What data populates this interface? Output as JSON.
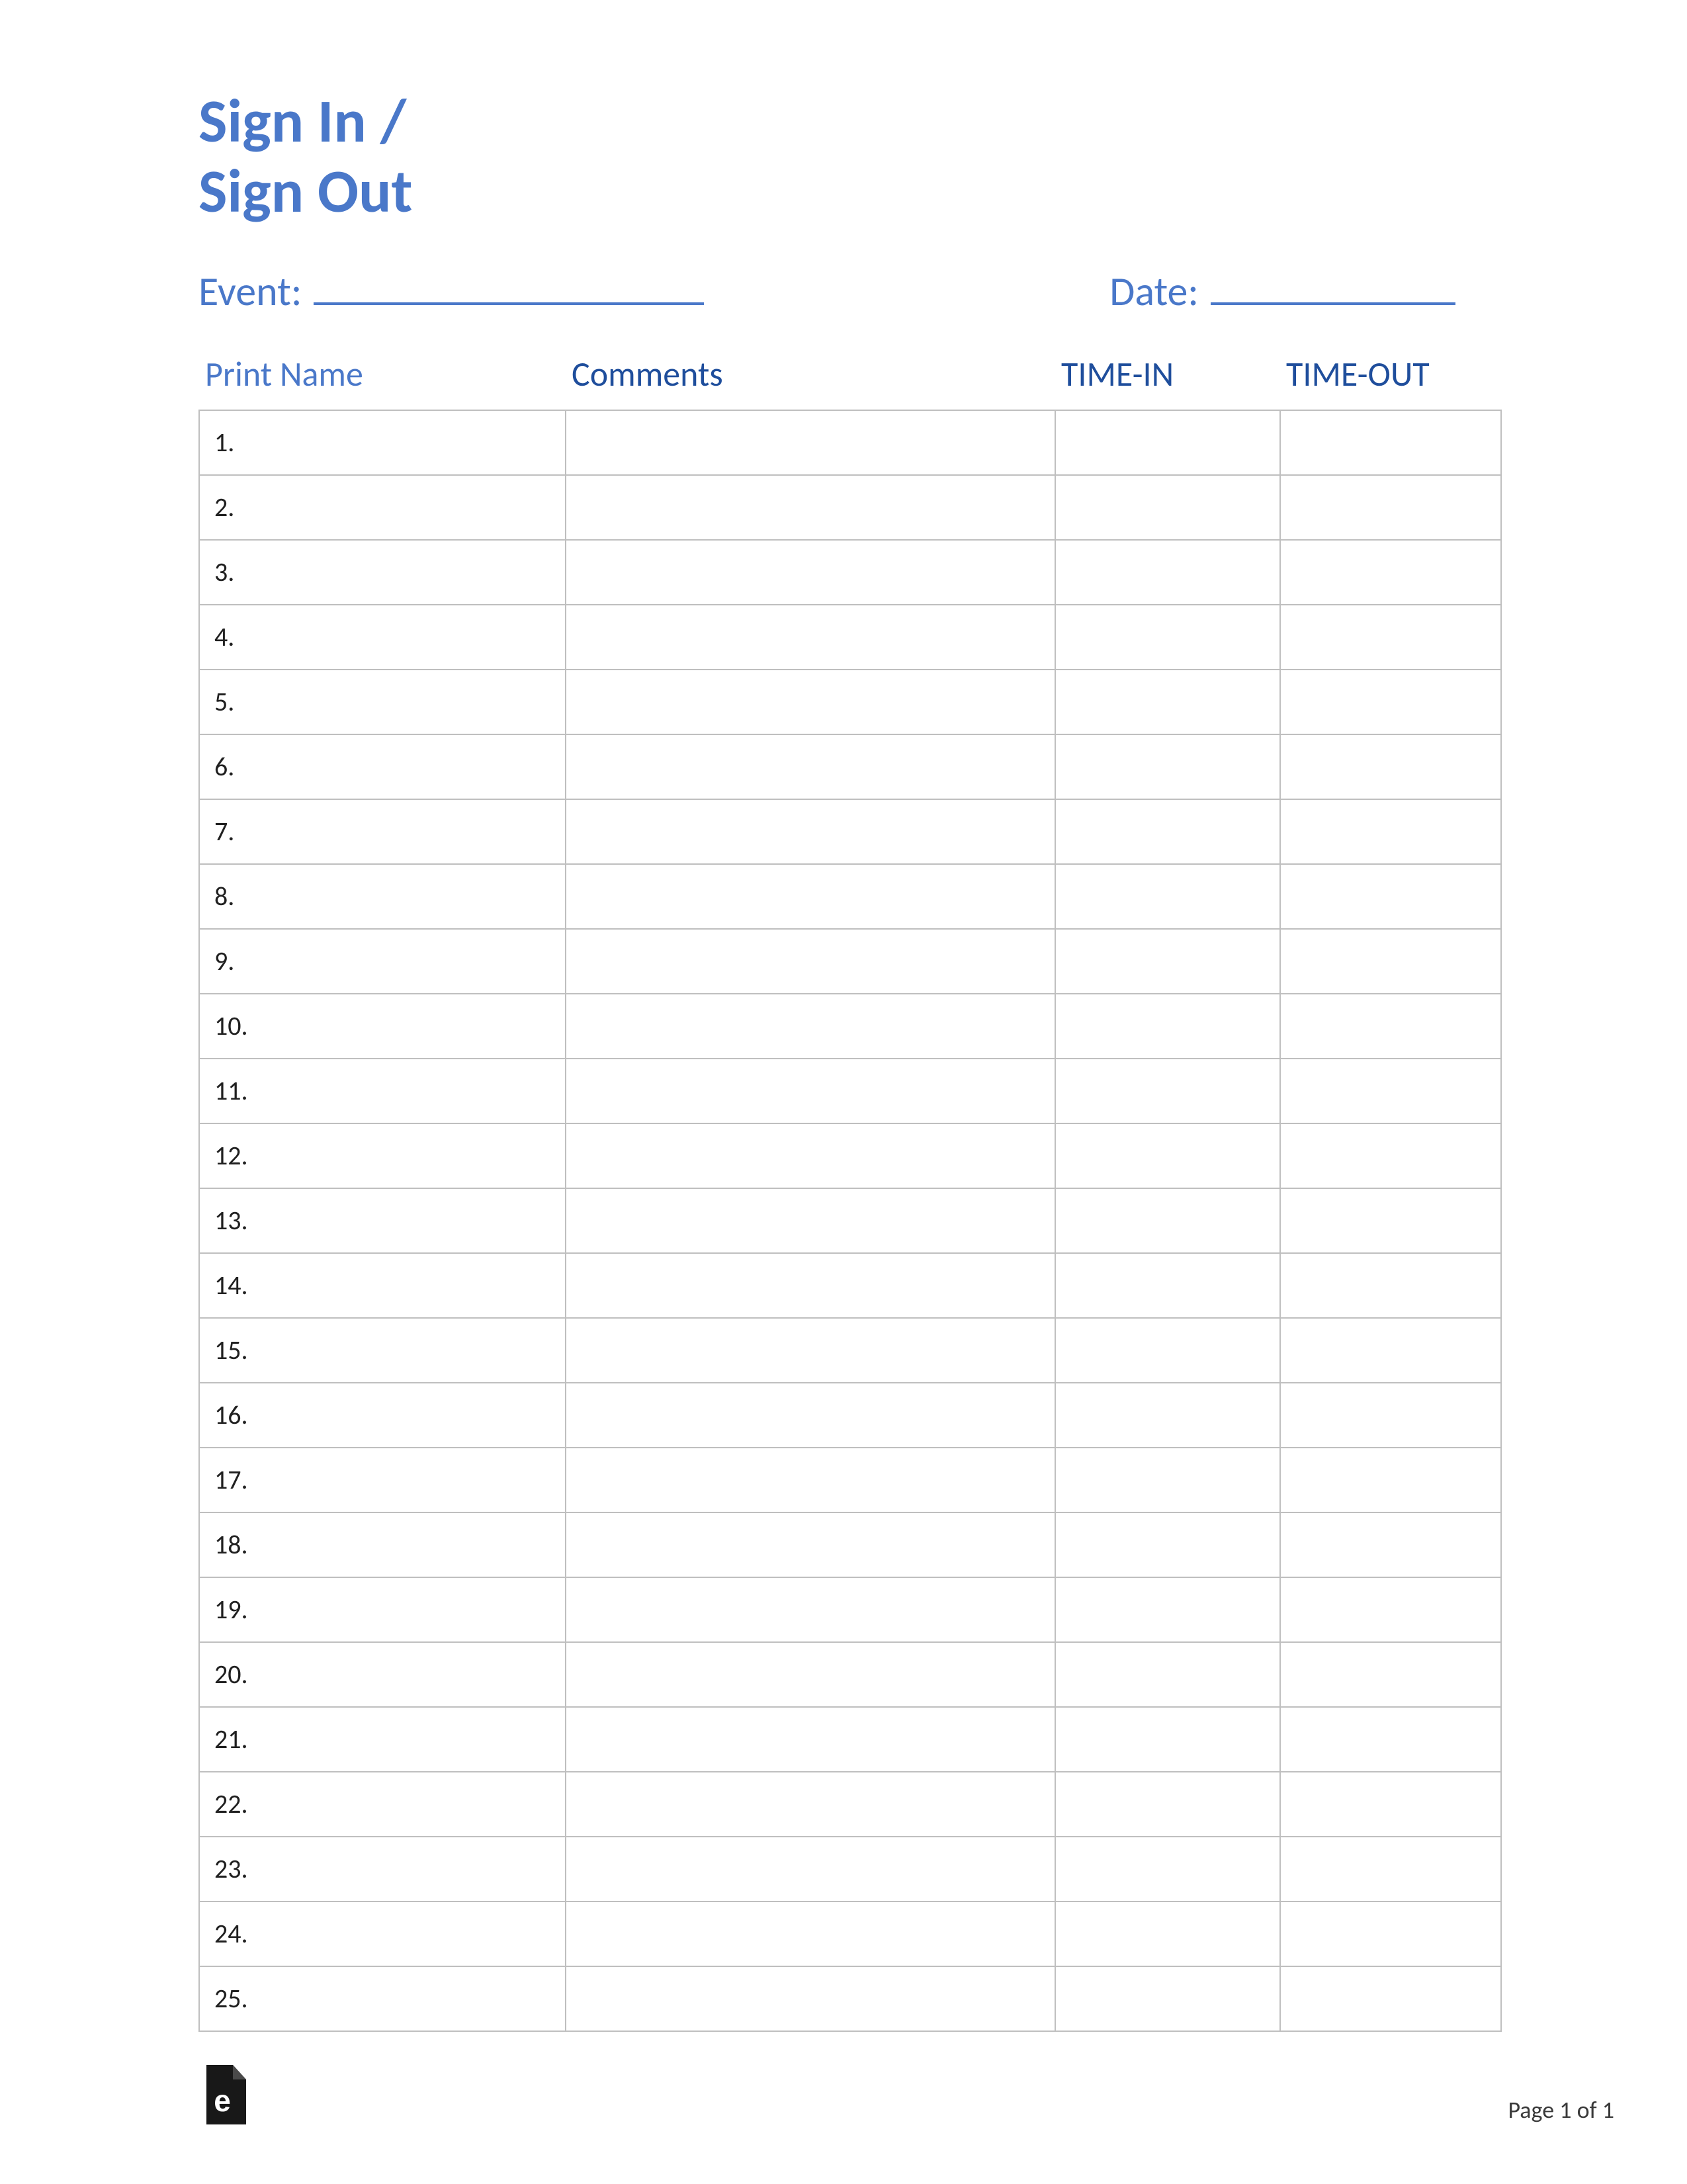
{
  "title_line1": "Sign In /",
  "title_line2": "Sign Out",
  "meta": {
    "event_label": "Event:",
    "date_label": "Date:"
  },
  "columns": {
    "name": "Print Name",
    "comments": "Comments",
    "time_in": "TIME-IN",
    "time_out": "TIME-OUT"
  },
  "rows": [
    "1.",
    "2.",
    "3.",
    "4.",
    "5.",
    "6.",
    "7.",
    "8.",
    "9.",
    "10.",
    "11.",
    "12.",
    "13.",
    "14.",
    "15.",
    "16.",
    "17.",
    "18.",
    "19.",
    "20.",
    "21.",
    "22.",
    "23.",
    "24.",
    "25."
  ],
  "footer": {
    "page_label": "Page 1 of 1"
  }
}
